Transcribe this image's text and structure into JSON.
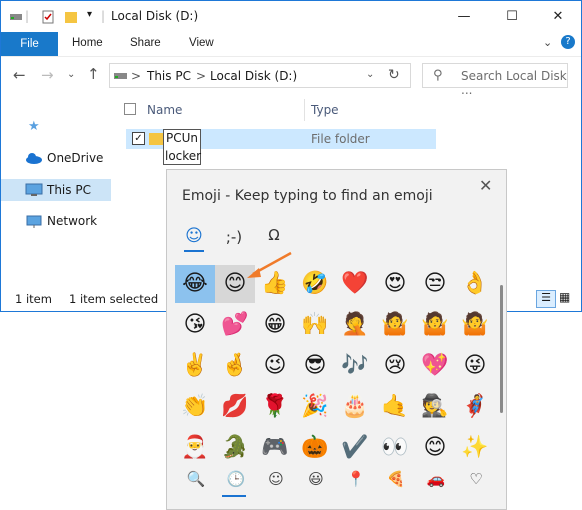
{
  "window": {
    "title": "Local Disk (D:)"
  },
  "ribbon": {
    "file": "File",
    "home": "Home",
    "share": "Share",
    "view": "View"
  },
  "address": {
    "this_pc": "This PC",
    "sep": ">",
    "disk": "Local Disk (D:)",
    "search_placeholder": "Search Local Disk ..."
  },
  "nav": {
    "onedrive": "OneDrive",
    "this_pc": "This PC",
    "network": "Network"
  },
  "list": {
    "col_name": "Name",
    "col_type": "Type",
    "row_name_line1": "PCUn",
    "row_name_line2": "locker",
    "row_type": "File folder"
  },
  "status": {
    "count": "1 item",
    "selected": "1 item selected"
  },
  "emoji_panel": {
    "title": "Emoji - Keep typing to find an emoji",
    "tabs": {
      "emoji": "☺",
      "kaomoji": ";-)",
      "symbols": "Ω"
    },
    "close": "✕",
    "rows": [
      [
        "😂",
        "😊",
        "👍",
        "🤣",
        "❤️",
        "😍",
        "😒",
        "👌"
      ],
      [
        "😘",
        "💕",
        "😁",
        "🙌",
        "🤦",
        "🤷",
        "🤷",
        "🤷"
      ],
      [
        "✌️",
        "🤞",
        "😉",
        "😎",
        "🎶",
        "😢",
        "💖",
        "😜"
      ],
      [
        "👏",
        "💋",
        "🌹",
        "🎉",
        "🎂",
        "🤙",
        "🕵️",
        "🦸"
      ],
      [
        "🎅",
        "🐊",
        "🎮",
        "🎃",
        "✔️",
        "👀",
        "😊",
        "✨"
      ]
    ],
    "categories": [
      "🔍",
      "🕒",
      "☺",
      "😃",
      "📍",
      "🍕",
      "🚗",
      "♡"
    ]
  }
}
